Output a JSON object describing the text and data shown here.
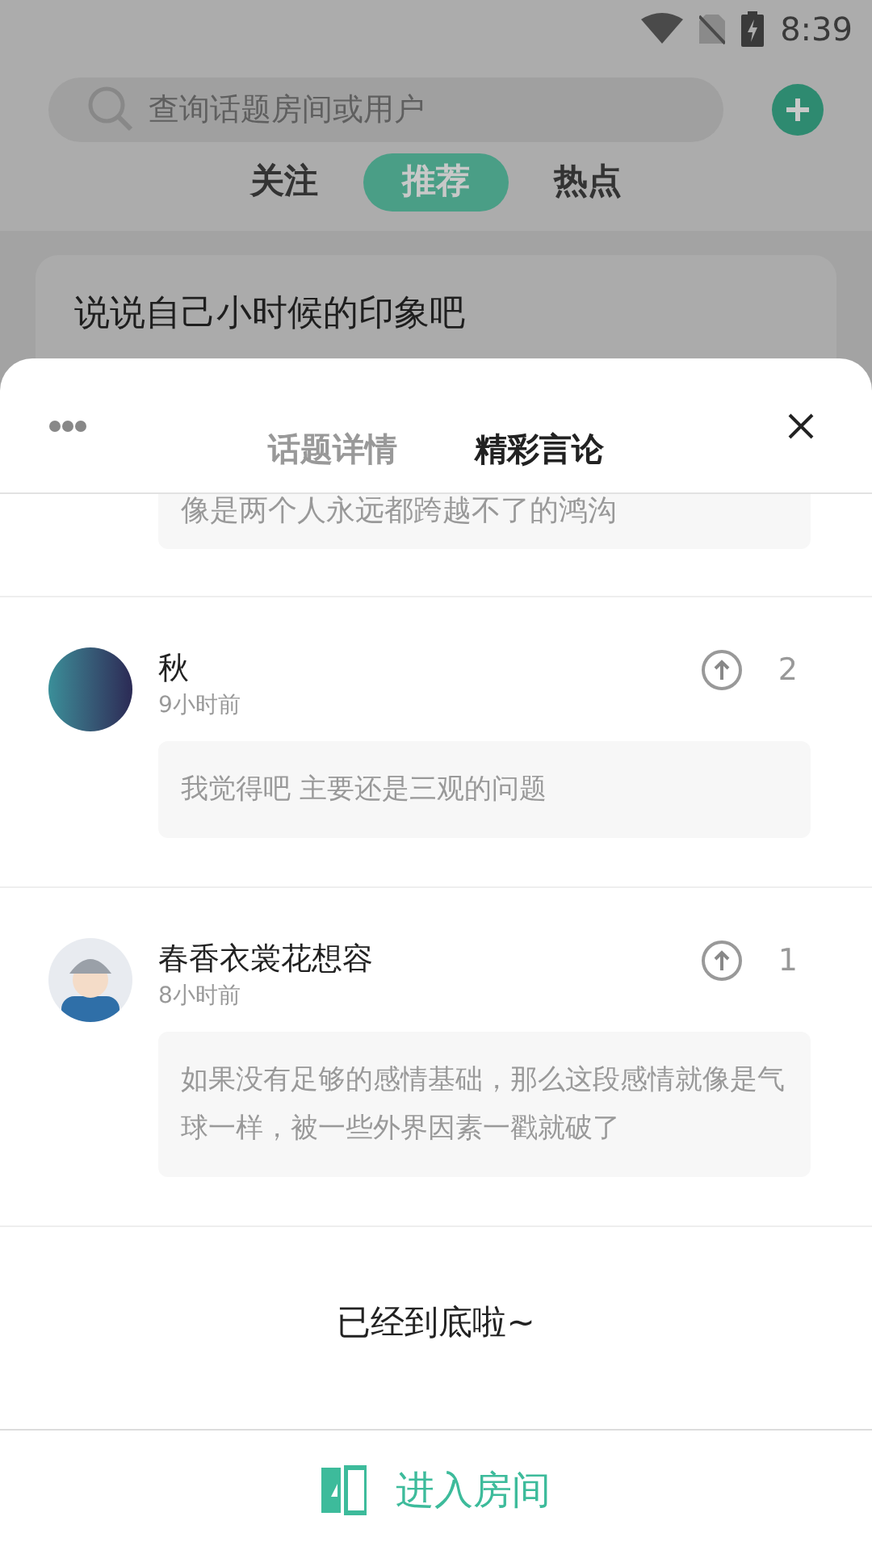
{
  "status_bar": {
    "time": "8:39"
  },
  "search": {
    "placeholder": "查询话题房间或用户"
  },
  "feed_tabs": [
    {
      "label": "关注",
      "selected": false
    },
    {
      "label": "推荐",
      "selected": true
    },
    {
      "label": "热点",
      "selected": false
    }
  ],
  "card": {
    "title": "说说自己小时候的印象吧"
  },
  "sheet": {
    "tabs": [
      {
        "label": "话题详情",
        "selected": false
      },
      {
        "label": "精彩言论",
        "selected": true
      }
    ],
    "partial_comment": "像是两个人永远都跨越不了的鸿沟",
    "comments": [
      {
        "user": "秋",
        "time": "9小时前",
        "votes": "2",
        "text": "我觉得吧 主要还是三观的问题",
        "kind": "gradient"
      },
      {
        "user": "春香衣裳花想容",
        "time": "8小时前",
        "votes": "1",
        "text": "如果没有足够的感情基础，那么这段感情就像是气球一样，被一些外界因素一戳就破了",
        "kind": "cartoon"
      }
    ],
    "end_text": "已经到底啦~",
    "enter_button": "进入房间"
  }
}
